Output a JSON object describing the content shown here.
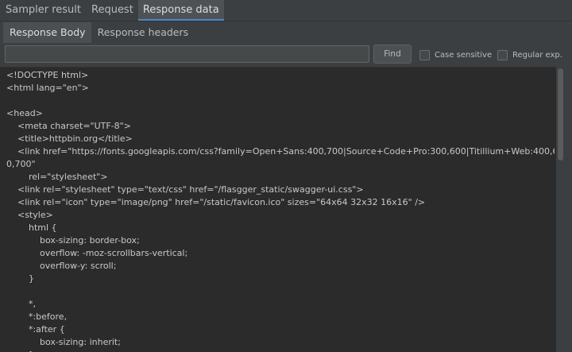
{
  "tabs": [
    {
      "label": "Sampler result",
      "active": false
    },
    {
      "label": "Request",
      "active": false
    },
    {
      "label": "Response data",
      "active": true
    }
  ],
  "subtabs": [
    {
      "label": "Response Body",
      "active": true
    },
    {
      "label": "Response headers",
      "active": false
    }
  ],
  "search": {
    "value": "",
    "find_label": "Find",
    "case_sensitive_label": "Case sensitive",
    "case_sensitive_checked": false,
    "regex_label": "Regular exp.",
    "regex_checked": false
  },
  "code_lines": [
    "<!DOCTYPE html>",
    "<html lang=\"en\">",
    "",
    "<head>",
    "    <meta charset=\"UTF-8\">",
    "    <title>httpbin.org</title>",
    "    <link href=\"https://fonts.googleapis.com/css?family=Open+Sans:400,700|Source+Code+Pro:300,600|Titillium+Web:400,60",
    "0,700\"",
    "        rel=\"stylesheet\">",
    "    <link rel=\"stylesheet\" type=\"text/css\" href=\"/flasgger_static/swagger-ui.css\">",
    "    <link rel=\"icon\" type=\"image/png\" href=\"/static/favicon.ico\" sizes=\"64x64 32x32 16x16\" />",
    "    <style>",
    "        html {",
    "            box-sizing: border-box;",
    "            overflow: -moz-scrollbars-vertical;",
    "            overflow-y: scroll;",
    "        }",
    "",
    "        *,",
    "        *:before,",
    "        *:after {",
    "            box-sizing: inherit;",
    "        }"
  ],
  "colors": {
    "panel_bg": "#3c3f41",
    "code_bg": "#2b2b2b",
    "text": "#bbbbbb",
    "active_tab_underline": "#4a88c7"
  }
}
